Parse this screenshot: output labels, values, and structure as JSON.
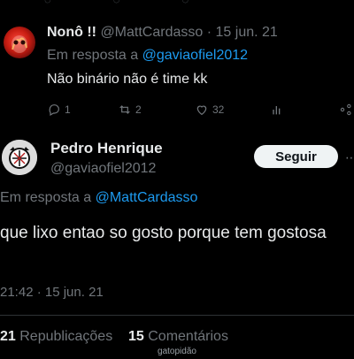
{
  "reply_tweet": {
    "display_name": "Nonô !!",
    "handle": "@MattCardasso",
    "separator": "·",
    "date": "15 jun. 21",
    "replying_prefix": "Em resposta a",
    "replying_to": "@gaviaofiel2012",
    "text": "Não binário não é time kk",
    "actions": {
      "replies": "1",
      "retweets": "2",
      "likes": "32"
    }
  },
  "main_tweet": {
    "display_name": "Pedro Henrique",
    "handle": "@gaviaofiel2012",
    "follow_label": "Seguir",
    "replying_prefix": "Em resposta a",
    "replying_to": "@MattCardasso",
    "text": "que lixo entao so gosto porque tem gostosa",
    "timestamp": "21:42 · 15 jun. 21",
    "stats": {
      "retweets_count": "21",
      "retweets_label": "Republicações",
      "comments_count": "15",
      "comments_label": "Comentários"
    }
  },
  "watermark": "gatopidão",
  "icons": {
    "reply": "reply-icon",
    "retweet": "retweet-icon",
    "like": "heart-icon",
    "views": "views-icon",
    "share": "share-icon",
    "more": "more-icon"
  },
  "colors": {
    "background": "#000000",
    "text": "#e7e9ea",
    "muted": "#71767b",
    "link": "#1d9bf0",
    "follow_bg": "#eff3f4"
  }
}
